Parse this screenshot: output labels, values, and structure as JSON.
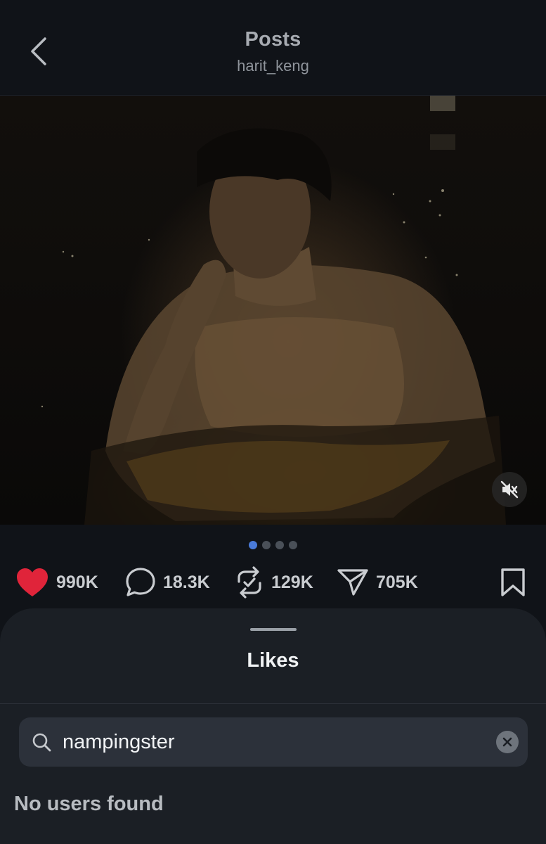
{
  "header": {
    "title": "Posts",
    "username": "harit_keng"
  },
  "media": {
    "pager": {
      "count": 4,
      "active_index": 0
    },
    "muted": true
  },
  "actions": {
    "likes": "990K",
    "comments": "18.3K",
    "reposts": "129K",
    "shares": "705K",
    "liked": true,
    "like_color": "#e0243a"
  },
  "sheet": {
    "title": "Likes",
    "search": {
      "value": "nampingster",
      "placeholder": "Search"
    },
    "empty_message": "No users found"
  },
  "icons": [
    "back-chevron-icon",
    "mute-icon",
    "heart-icon",
    "comment-icon",
    "repost-icon",
    "share-icon",
    "bookmark-icon",
    "search-icon",
    "clear-icon"
  ],
  "colors": {
    "background": "#101318",
    "sheet": "#1b1f25",
    "accent_dot": "#4a7bd9"
  }
}
